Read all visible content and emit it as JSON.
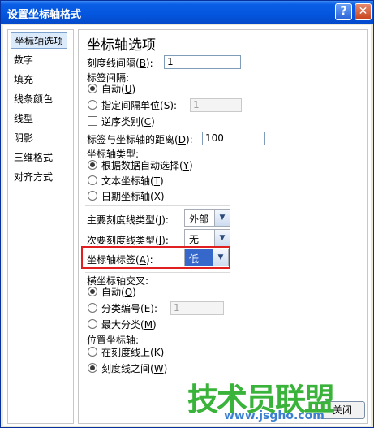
{
  "window": {
    "title": "设置坐标轴格式",
    "help_glyph": "?",
    "close_glyph": "✕"
  },
  "sidebar": {
    "items": [
      {
        "label": "坐标轴选项",
        "selected": true
      },
      {
        "label": "数字"
      },
      {
        "label": "填充"
      },
      {
        "label": "线条颜色"
      },
      {
        "label": "线型"
      },
      {
        "label": "阴影"
      },
      {
        "label": "三维格式"
      },
      {
        "label": "对齐方式"
      }
    ]
  },
  "panel": {
    "heading": "坐标轴选项",
    "tick_interval": {
      "label": "刻度线间隔(",
      "key": "B",
      "suffix": "):",
      "value": "1"
    },
    "label_interval": {
      "label": "标签间隔:",
      "auto": {
        "label": "自动(",
        "key": "U",
        "suffix": ")"
      },
      "specify": {
        "label": "指定间隔单位(",
        "key": "S",
        "suffix": "):",
        "value": "1"
      }
    },
    "reverse": {
      "label": "逆序类别(",
      "key": "C",
      "suffix": ")"
    },
    "label_distance": {
      "label": "标签与坐标轴的距离(",
      "key": "D",
      "suffix": "):",
      "value": "100"
    },
    "axis_type": {
      "label": "坐标轴类型:",
      "options": [
        {
          "label": "根据数据自动选择(",
          "key": "Y",
          "suffix": ")",
          "checked": true
        },
        {
          "label": "文本坐标轴(",
          "key": "T",
          "suffix": ")"
        },
        {
          "label": "日期坐标轴(",
          "key": "X",
          "suffix": ")"
        }
      ]
    },
    "major_tick": {
      "label": "主要刻度线类型(",
      "key": "J",
      "suffix": "):",
      "value": "外部"
    },
    "minor_tick": {
      "label": "次要刻度线类型(",
      "key": "I",
      "suffix": "):",
      "value": "无"
    },
    "axis_labels": {
      "label": "坐标轴标签(",
      "key": "A",
      "suffix": "):",
      "value": "低"
    },
    "cross": {
      "label": "横坐标轴交叉:",
      "auto": {
        "label": "自动(",
        "key": "O",
        "suffix": ")",
        "checked": true
      },
      "category": {
        "label": "分类编号(",
        "key": "E",
        "suffix": "):",
        "value": "1"
      },
      "max": {
        "label": "最大分类(",
        "key": "M",
        "suffix": ")"
      }
    },
    "position": {
      "label": "位置坐标轴:",
      "on_ticks": {
        "label": "在刻度线上(",
        "key": "K",
        "suffix": ")"
      },
      "between": {
        "label": "刻度线之间(",
        "key": "W",
        "suffix": ")",
        "checked": true
      }
    }
  },
  "footer": {
    "close_label": "关闭"
  },
  "watermark": {
    "text": "技术员联盟",
    "url": "www.jsgho.com"
  },
  "colors": {
    "titlebar": "#0455dd",
    "highlight_border": "#e02020",
    "watermark": "#39b33a"
  }
}
